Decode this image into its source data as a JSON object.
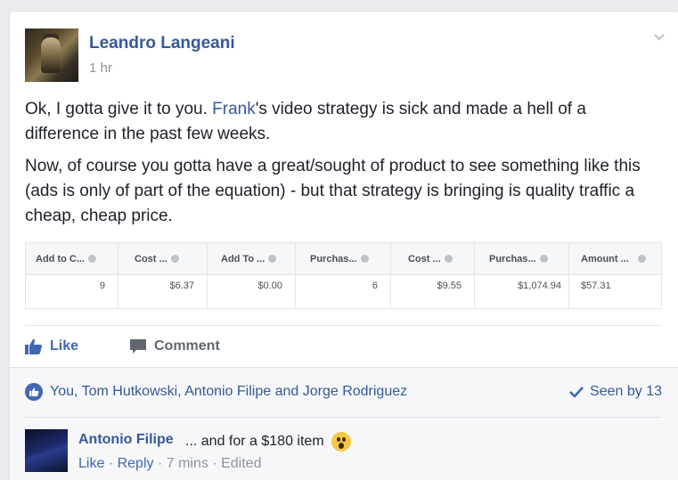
{
  "post": {
    "author": "Leandro Langeani",
    "time": "1 hr",
    "paragraph1_before": "Ok, I gotta give it to you. ",
    "paragraph1_link": "Frank",
    "paragraph1_after": "'s video strategy is sick and made a hell of a difference in the past few weeks.",
    "paragraph2": "Now, of course you gotta have a great/sought of product to see something like this (ads is only of part of the equation) - but that strategy is bringing is quality traffic a cheap, cheap price."
  },
  "stats_table": {
    "headers": [
      "Add to C...",
      "Cost ...",
      "Add To ...",
      "Purchas...",
      "Cost ...",
      "Purchas...",
      "Amount ..."
    ],
    "values": [
      "9",
      "$6.37",
      "$0.00",
      "6",
      "$9.55",
      "$1,074.94",
      "$57.31"
    ]
  },
  "actions": {
    "like_label": "Like",
    "comment_label": "Comment"
  },
  "reactions": {
    "likers": "You, Tom Hutkowski, Antonio Filipe and Jorge Rodriguez",
    "seen_by": "Seen by 13"
  },
  "comment": {
    "author": "Antonio Filipe",
    "text": "... and for a $180 item",
    "like_label": "Like",
    "reply_label": "Reply",
    "time": "7 mins",
    "edited": "Edited",
    "separator": "·"
  },
  "colors": {
    "link_blue": "#365899",
    "action_blue": "#4267b2",
    "muted_gray": "#90949c",
    "background": "#e9ebee"
  },
  "icons": [
    "chevron-down-icon",
    "thumbs-up-icon",
    "comment-icon",
    "like-reaction-icon",
    "checkmark-icon",
    "surprised-emoji-icon",
    "info-icon"
  ]
}
